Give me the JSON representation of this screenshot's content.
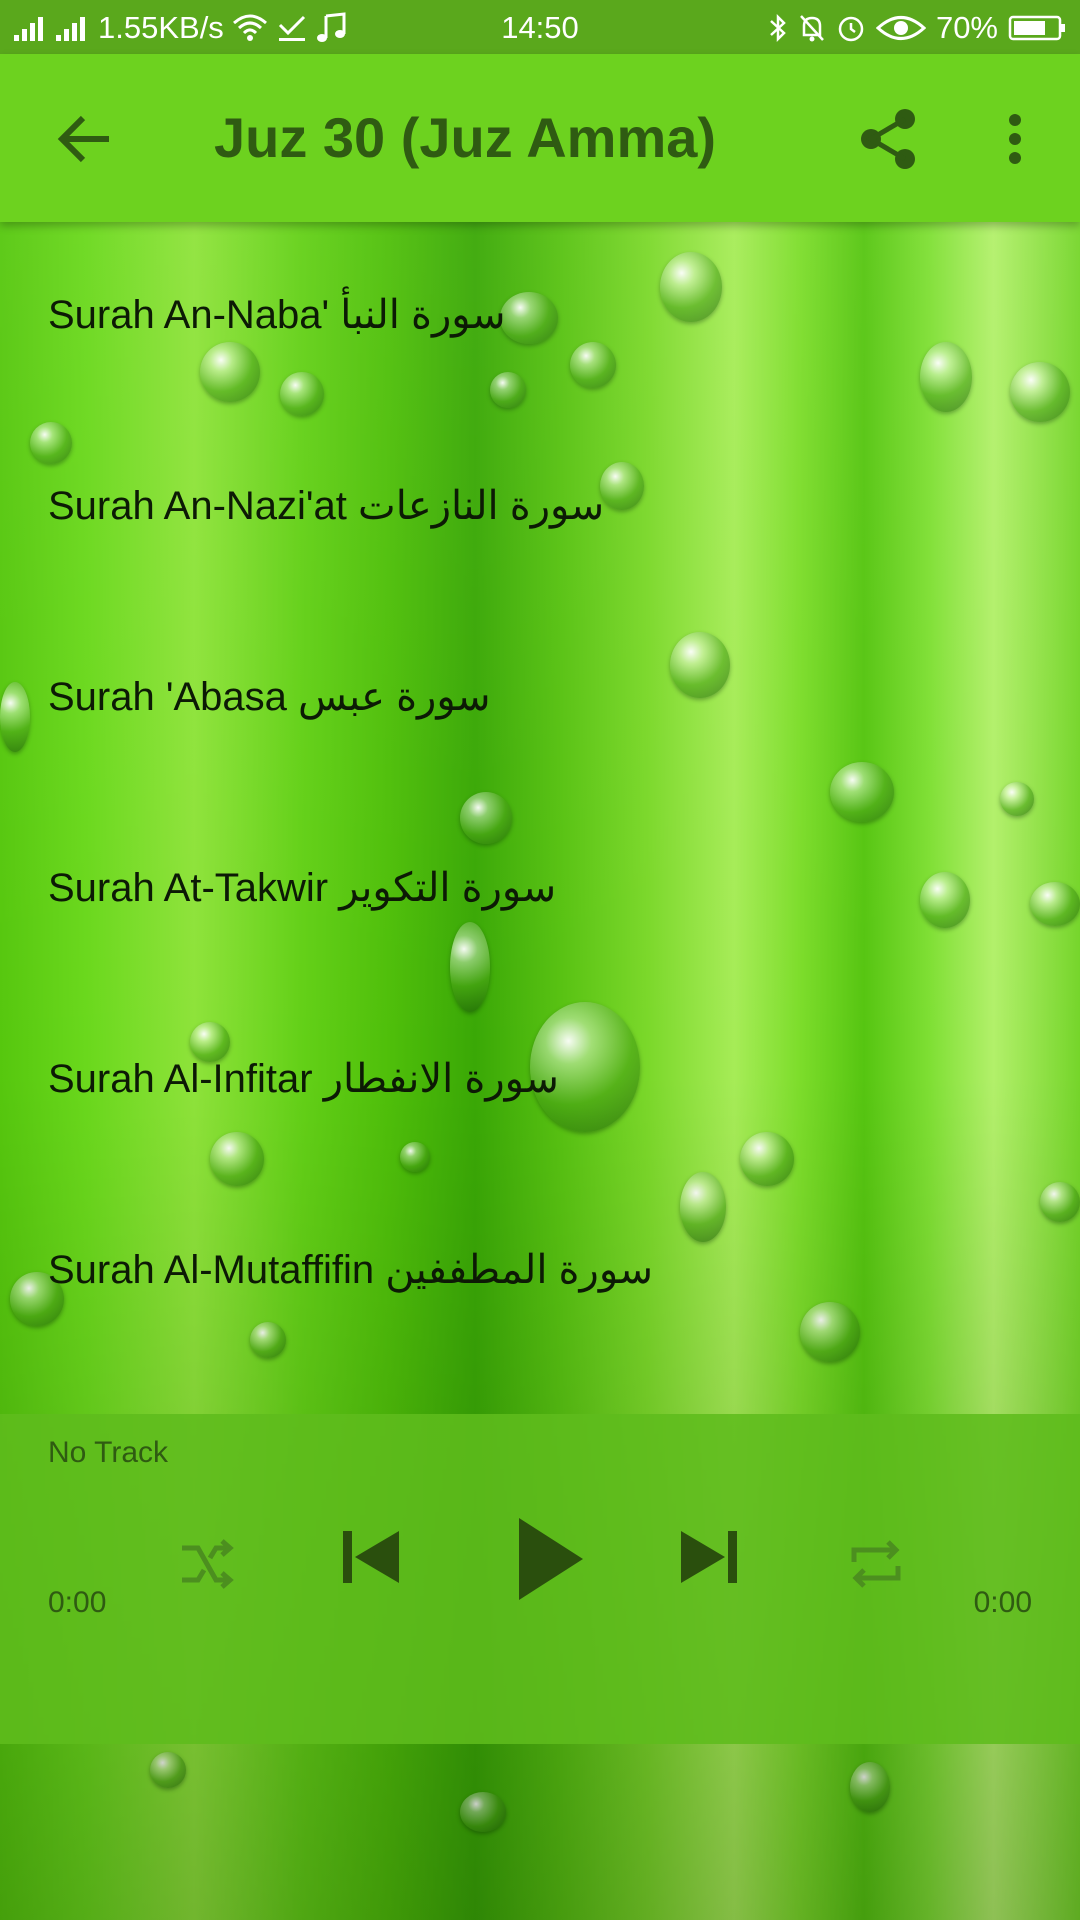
{
  "status_bar": {
    "network_speed": "1.55KB/s",
    "time": "14:50",
    "battery": "70%",
    "icons": [
      "signal-icon",
      "signal-icon",
      "wifi-icon",
      "download-done-icon",
      "music-note-icon",
      "bluetooth-icon",
      "mute-icon",
      "alarm-icon",
      "eye-icon",
      "battery-icon"
    ]
  },
  "app_bar": {
    "title": "Juz 30 (Juz Amma)",
    "back_icon": "arrow-left-icon",
    "share_icon": "share-icon",
    "more_icon": "more-vertical-icon"
  },
  "surahs": [
    {
      "label": "Surah An-Naba' سورة النبأ"
    },
    {
      "label": "Surah An-Nazi'at سورة النازعات"
    },
    {
      "label": "Surah 'Abasa سورة عبس"
    },
    {
      "label": "Surah At-Takwir سورة التكوير"
    },
    {
      "label": "Surah Al-Infitar سورة الانفطار"
    },
    {
      "label": "Surah Al-Mutaffifin سورة المطففين"
    }
  ],
  "player": {
    "track": "No Track",
    "current_time": "0:00",
    "total_time": "0:00",
    "controls": [
      "shuffle-icon",
      "skip-previous-icon",
      "play-icon",
      "skip-next-icon",
      "repeat-icon"
    ]
  },
  "colors": {
    "status_bar": "#5aa81c",
    "app_bar": "#6dd21f",
    "title_text": "#2f5b12",
    "player_bg": "#5ebc1c"
  }
}
